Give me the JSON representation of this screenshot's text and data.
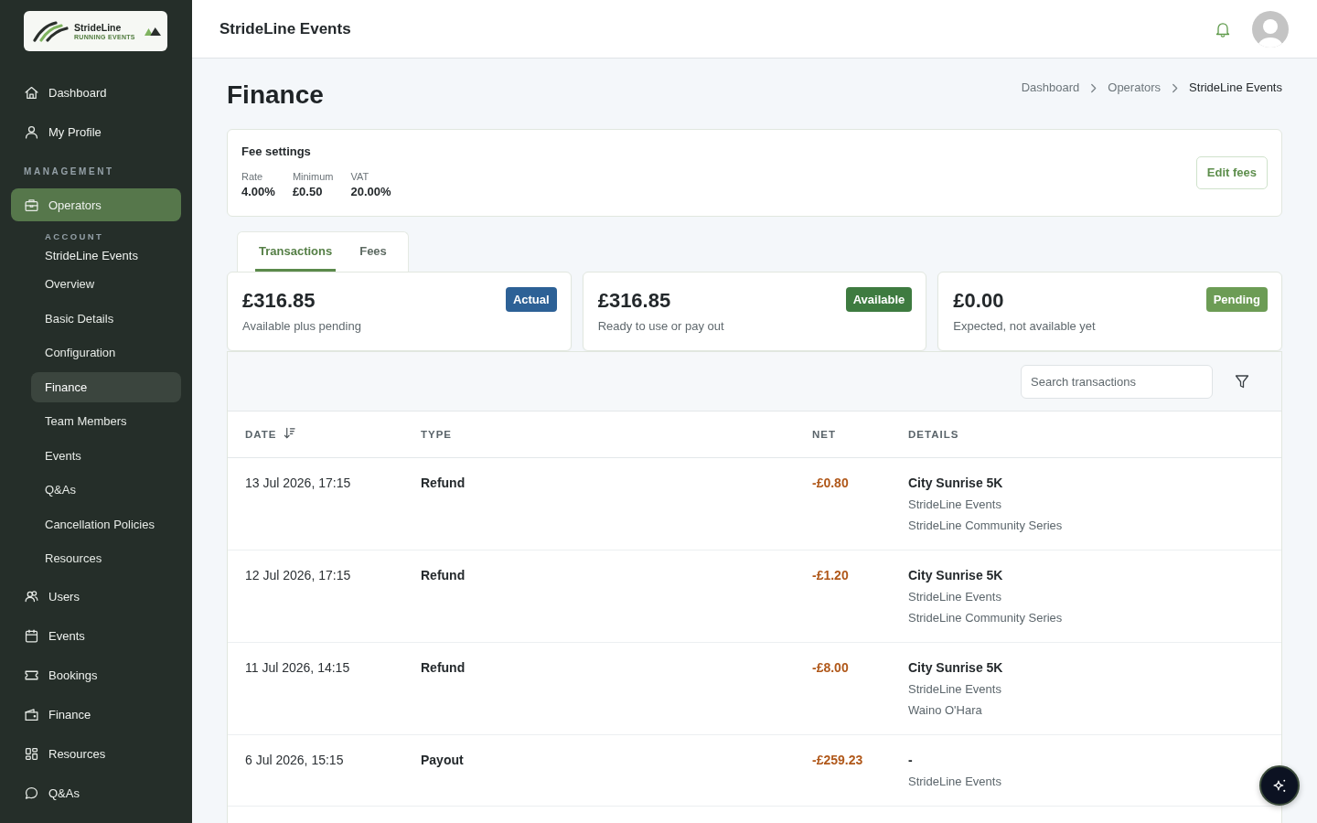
{
  "sidebar": {
    "logo": {
      "name": "StrideLine",
      "tagline": "RUNNING EVENTS"
    },
    "nav": [
      {
        "kind": "link",
        "label": "Dashboard",
        "selected": false
      },
      {
        "kind": "link",
        "label": "My Profile",
        "selected": false
      },
      {
        "kind": "section",
        "label": "MANAGEMENT"
      },
      {
        "kind": "link",
        "label": "Operators",
        "selected": true,
        "account": {
          "caption": "ACCOUNT",
          "name": "StrideLine Events"
        },
        "children": [
          {
            "label": "Overview",
            "selected": false
          },
          {
            "label": "Basic Details",
            "selected": false
          },
          {
            "label": "Configuration",
            "selected": false
          },
          {
            "label": "Finance",
            "selected": true
          },
          {
            "label": "Team Members",
            "selected": false
          },
          {
            "label": "Events",
            "selected": false
          },
          {
            "label": "Q&As",
            "selected": false
          },
          {
            "label": "Cancellation Policies",
            "selected": false
          },
          {
            "label": "Resources",
            "selected": false
          }
        ]
      },
      {
        "kind": "link",
        "label": "Users",
        "selected": false
      },
      {
        "kind": "link",
        "label": "Events",
        "selected": false
      },
      {
        "kind": "link",
        "label": "Bookings",
        "selected": false
      },
      {
        "kind": "link",
        "label": "Finance",
        "selected": false
      },
      {
        "kind": "link",
        "label": "Resources",
        "selected": false
      },
      {
        "kind": "link",
        "label": "Q&As",
        "selected": false
      }
    ]
  },
  "header": {
    "title": "StrideLine Events"
  },
  "page": {
    "title": "Finance",
    "breadcrumb": [
      {
        "label": "Dashboard",
        "current": false
      },
      {
        "label": "Operators",
        "current": false
      },
      {
        "label": "StrideLine Events",
        "current": true
      }
    ]
  },
  "fee_settings": {
    "title": "Fee settings",
    "fields": [
      {
        "label": "Rate",
        "value": "4.00%"
      },
      {
        "label": "Minimum",
        "value": "£0.50"
      },
      {
        "label": "VAT",
        "value": "20.00%"
      }
    ],
    "button": "Edit fees"
  },
  "tabs": [
    {
      "label": "Transactions",
      "selected": true
    },
    {
      "label": "Fees",
      "selected": false
    }
  ],
  "balances": [
    {
      "amount": "£316.85",
      "caption": "Available plus pending",
      "badge": "Actual",
      "color": "#2d6196"
    },
    {
      "amount": "£316.85",
      "caption": "Ready to use or pay out",
      "badge": "Available",
      "color": "#3e7b40"
    },
    {
      "amount": "£0.00",
      "caption": "Expected, not available yet",
      "badge": "Pending",
      "color": "#6c9c55"
    }
  ],
  "transactions": {
    "search": {
      "placeholder": "Search transactions"
    },
    "columns": [
      {
        "label": "DATE",
        "sorted": true
      },
      {
        "label": "TYPE",
        "sorted": false
      },
      {
        "label": "NET",
        "sorted": false
      },
      {
        "label": "DETAILS",
        "sorted": false
      }
    ],
    "rows": [
      {
        "date": "13 Jul 2026, 17:15",
        "type": "Refund",
        "net": "-£0.80",
        "details": [
          "City Sunrise 5K",
          "StrideLine Events",
          "StrideLine Community Series"
        ]
      },
      {
        "date": "12 Jul 2026, 17:15",
        "type": "Refund",
        "net": "-£1.20",
        "details": [
          "City Sunrise 5K",
          "StrideLine Events",
          "StrideLine Community Series"
        ]
      },
      {
        "date": "11 Jul 2026, 14:15",
        "type": "Refund",
        "net": "-£8.00",
        "details": [
          "City Sunrise 5K",
          "StrideLine Events",
          "Waino O'Hara"
        ]
      },
      {
        "date": "6 Jul 2026, 15:15",
        "type": "Payout",
        "net": "-£259.23",
        "details": [
          "-",
          "StrideLine Events"
        ]
      }
    ]
  }
}
